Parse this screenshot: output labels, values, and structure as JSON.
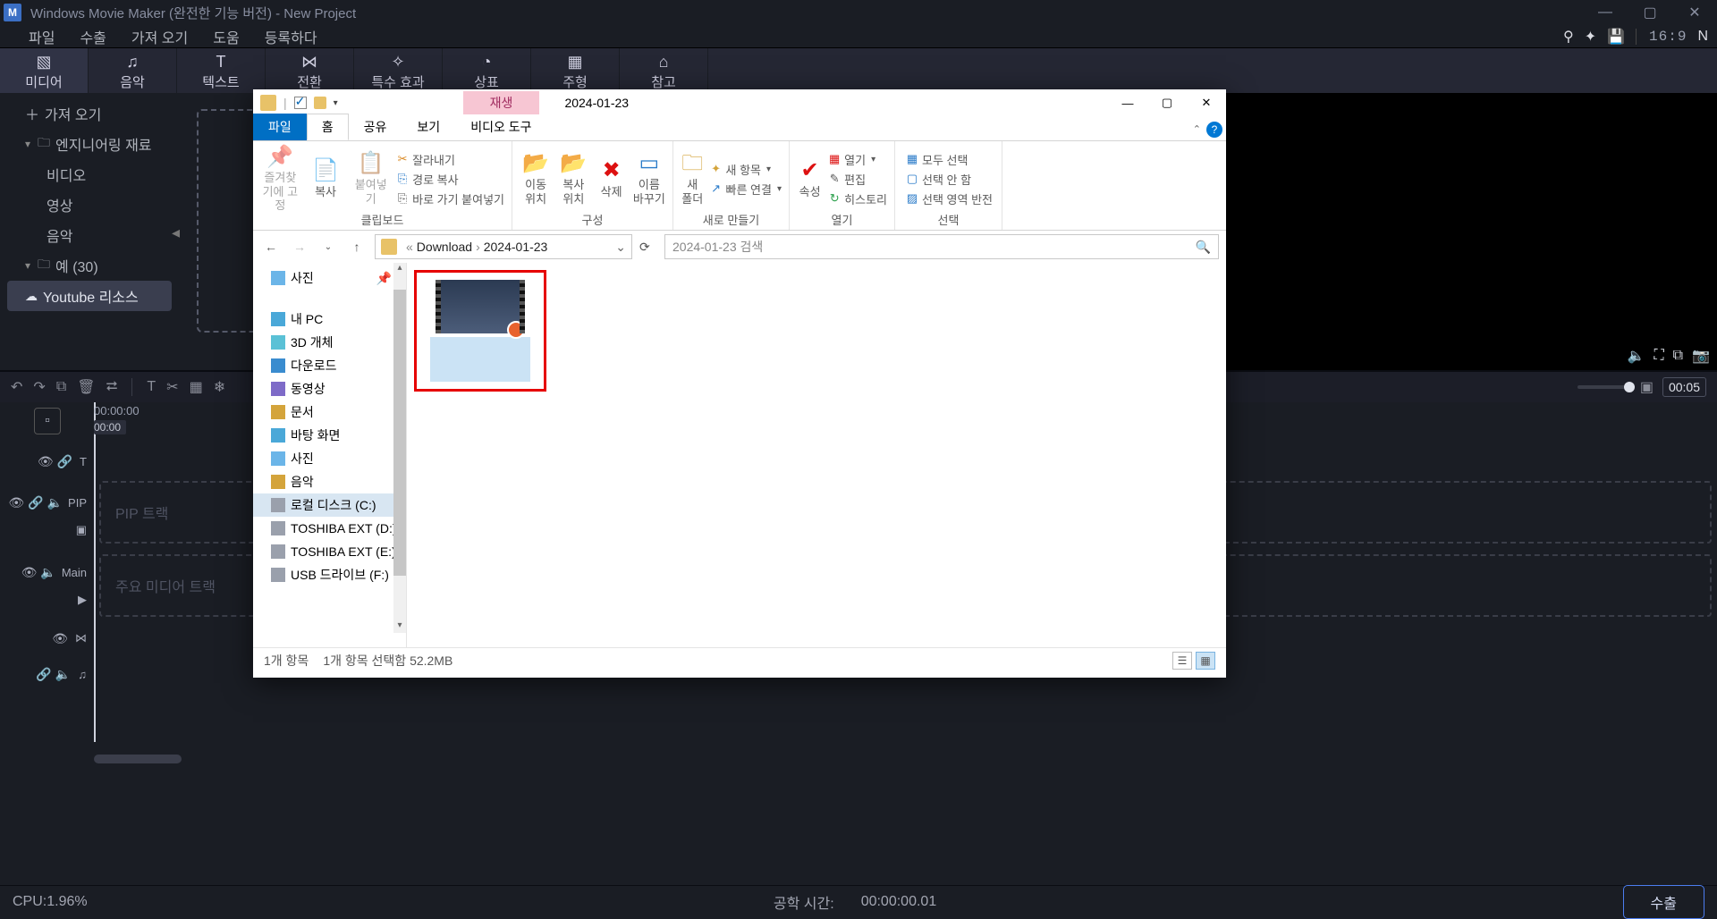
{
  "app": {
    "title": "Windows Movie Maker (완전한 기능 버전) - New Project",
    "aspect_label": "16:9",
    "n_badge": "N"
  },
  "menu": {
    "file": "파일",
    "export": "수출",
    "import": "가져 오기",
    "help": "도움",
    "register": "등록하다"
  },
  "tabs": {
    "media": "미디어",
    "music": "음악",
    "text": "텍스트",
    "transition": "전환",
    "effects": "특수 효과",
    "symbol": "상표",
    "annotation": "주형",
    "reference": "참고"
  },
  "sidebar": {
    "import": "가져 오기",
    "engineering": "엔지니어링 재료",
    "video": "비디오",
    "image": "영상",
    "audio": "음악",
    "samples": "예 (30)",
    "youtube": "Youtube 리소스"
  },
  "timeline_toolbar": {
    "time_box": "00:05"
  },
  "timeline": {
    "time_start": "00:00:00",
    "time_small": "00:00",
    "pip_label": "PIP",
    "pip_track": "PIP 트랙",
    "main_label": "Main",
    "main_track": "주요 미디어 트랙"
  },
  "status": {
    "cpu": "CPU:1.96%",
    "duration_label": "공학 시간:",
    "duration_value": "00:00:00.01",
    "export_btn": "수출"
  },
  "explorer": {
    "ctx_tab_group": "재생",
    "path_title": "2024-01-23",
    "tabs": {
      "file": "파일",
      "home": "홈",
      "share": "공유",
      "view": "보기",
      "video": "비디오 도구"
    },
    "ribbon": {
      "clipboard": {
        "pin": "즐겨찾기에 고정",
        "copy": "복사",
        "paste": "붙여넣기",
        "cut": "잘라내기",
        "copy_path": "경로 복사",
        "paste_shortcut": "바로 가기 붙여넣기",
        "group": "클립보드"
      },
      "organize": {
        "move": "이동 위치",
        "copy_to": "복사 위치",
        "delete": "삭제",
        "rename": "이름 바꾸기",
        "group": "구성"
      },
      "new": {
        "new_folder": "새 폴더",
        "new_item": "새 항목",
        "quick_link": "빠른 연결",
        "group": "새로 만들기"
      },
      "open": {
        "props": "속성",
        "open": "열기",
        "edit": "편집",
        "history": "히스토리",
        "group": "열기"
      },
      "select": {
        "all": "모두 선택",
        "none": "선택 안 함",
        "invert": "선택 영역 반전",
        "group": "선택"
      }
    },
    "breadcrumb": {
      "c1": "Download",
      "c2": "2024-01-23"
    },
    "search_placeholder": "2024-01-23 검색",
    "nav": {
      "photos": "사진",
      "my_pc": "내 PC",
      "objects3d": "3D 개체",
      "downloads": "다운로드",
      "videos": "동영상",
      "documents": "문서",
      "desktop": "바탕 화면",
      "pictures": "사진",
      "music": "음악",
      "local_c": "로컬 디스크 (C:)",
      "toshiba_d": "TOSHIBA EXT (D:)",
      "toshiba_e": "TOSHIBA EXT (E:)",
      "usb_f": "USB 드라이브 (F:)"
    },
    "status": {
      "count": "1개 항목",
      "selected": "1개 항목 선택함 52.2MB"
    }
  }
}
